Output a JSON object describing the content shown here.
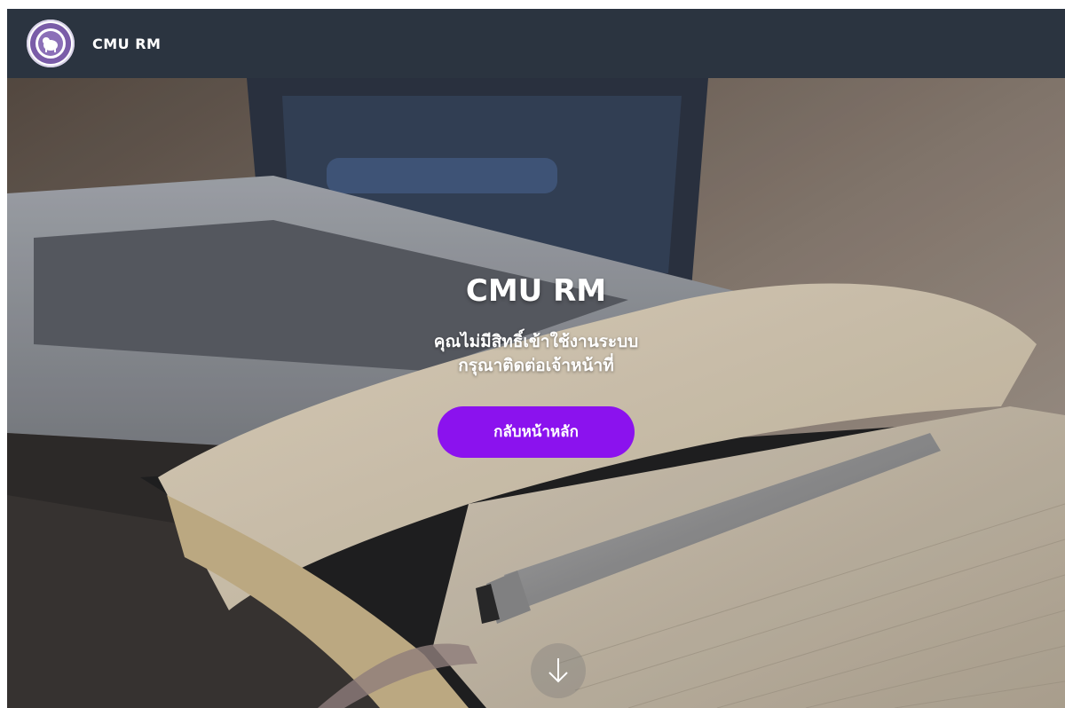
{
  "navbar": {
    "brand": "CMU RM",
    "logo_icon": "cmu-seal-icon"
  },
  "hero": {
    "title": "CMU RM",
    "message_line1": "คุณไม่มีสิทธิ์เข้าใช้งานระบบ",
    "message_line2": "กรุณาติดต่อเจ้าหน้าที่",
    "button_label": "กลับหน้าหลัก",
    "scroll_icon": "arrow-down-icon"
  },
  "colors": {
    "navbar": "#2b3440",
    "button": "#8b12ee",
    "text": "#ffffff"
  }
}
